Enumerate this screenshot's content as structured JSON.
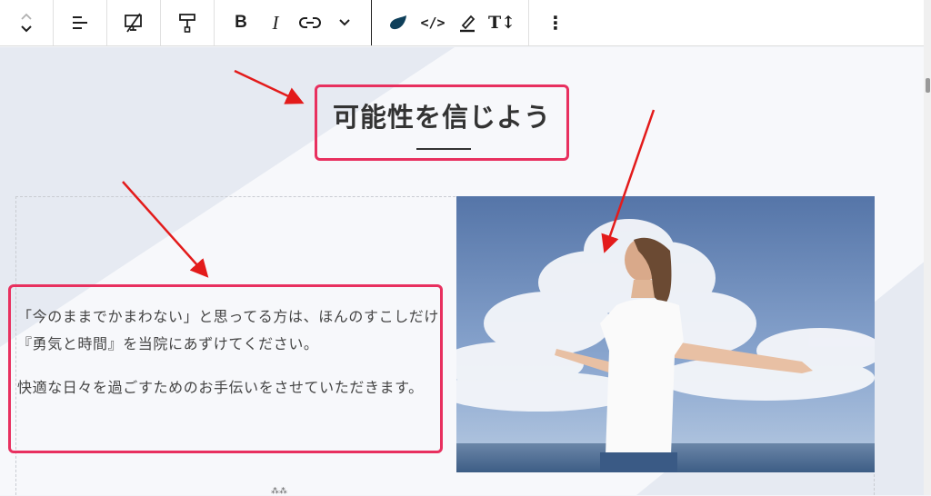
{
  "toolbar": {
    "buttons": [
      {
        "name": "move-up-down",
        "icon": "chevron-up-down-icon"
      },
      {
        "name": "align",
        "icon": "align-icon"
      },
      {
        "name": "hide-device",
        "icon": "device-hide-icon"
      },
      {
        "name": "format",
        "icon": "paint-roller-icon"
      },
      {
        "name": "bold",
        "label": "B"
      },
      {
        "name": "italic",
        "label": "I"
      },
      {
        "name": "link",
        "icon": "link-icon"
      },
      {
        "name": "more-rich-text",
        "icon": "chevron-down-icon"
      },
      {
        "name": "highlight",
        "icon": "leaf-icon"
      },
      {
        "name": "code",
        "label": "</>"
      },
      {
        "name": "text-color",
        "icon": "marker-icon"
      },
      {
        "name": "font-size",
        "label": "T↕"
      },
      {
        "name": "options",
        "label": "⋮"
      }
    ]
  },
  "heading": {
    "title": "可能性を信じよう"
  },
  "content": {
    "paragraph1": "「今のままでかまわない」と思ってる方は、ほんのすこしだけ『勇気と時間』を当院にあずけてください。",
    "paragraph2": "快適な日々を過ごすためのお手伝いをさせていただきます。"
  },
  "image": {
    "description_icon": "photo-icon"
  },
  "bottom": {
    "hint": "⁂⁂"
  },
  "colors": {
    "highlight_box": "#e8305f",
    "arrow": "#e31b1b",
    "leaf": "#0e3f5a"
  }
}
